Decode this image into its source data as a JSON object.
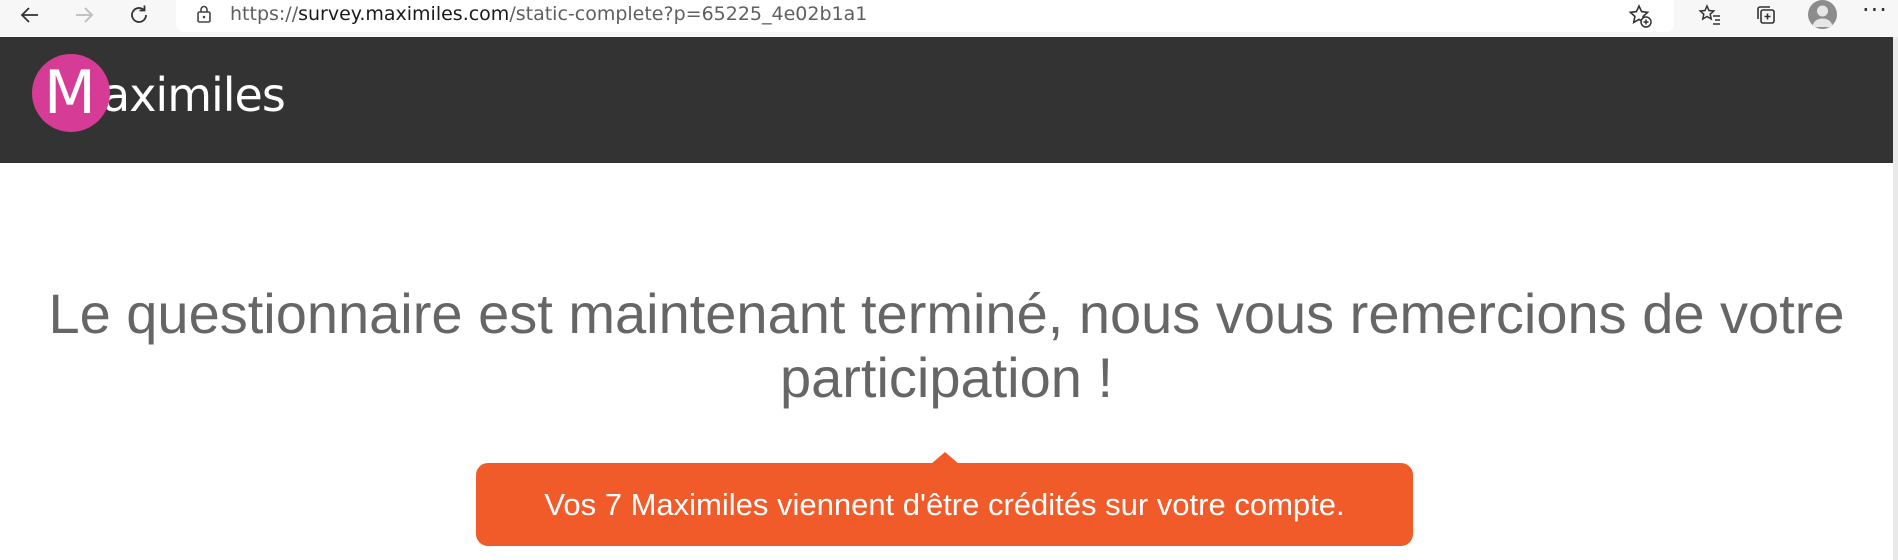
{
  "browser": {
    "url_prefix": "https://",
    "url_host": "survey.maximiles.com",
    "url_path": "/static-complete?p=65225_4e02b1a1"
  },
  "site": {
    "logo_initial": "M",
    "logo_rest": "aximiles",
    "brand_colors": {
      "header": "#333333",
      "logo_circle": "#d63c96",
      "accent": "#f15a29"
    }
  },
  "main": {
    "message": "Le questionnaire est maintenant terminé, nous vous remercions de votre participation !",
    "credit_notice": "Vos 7 Maximiles viennent d'être crédités sur votre compte."
  },
  "icons": [
    "back-arrow-icon",
    "forward-arrow-icon",
    "refresh-icon",
    "lock-icon",
    "add-favorite-icon",
    "favorites-icon",
    "collections-icon",
    "profile-avatar-icon",
    "more-options-icon"
  ]
}
